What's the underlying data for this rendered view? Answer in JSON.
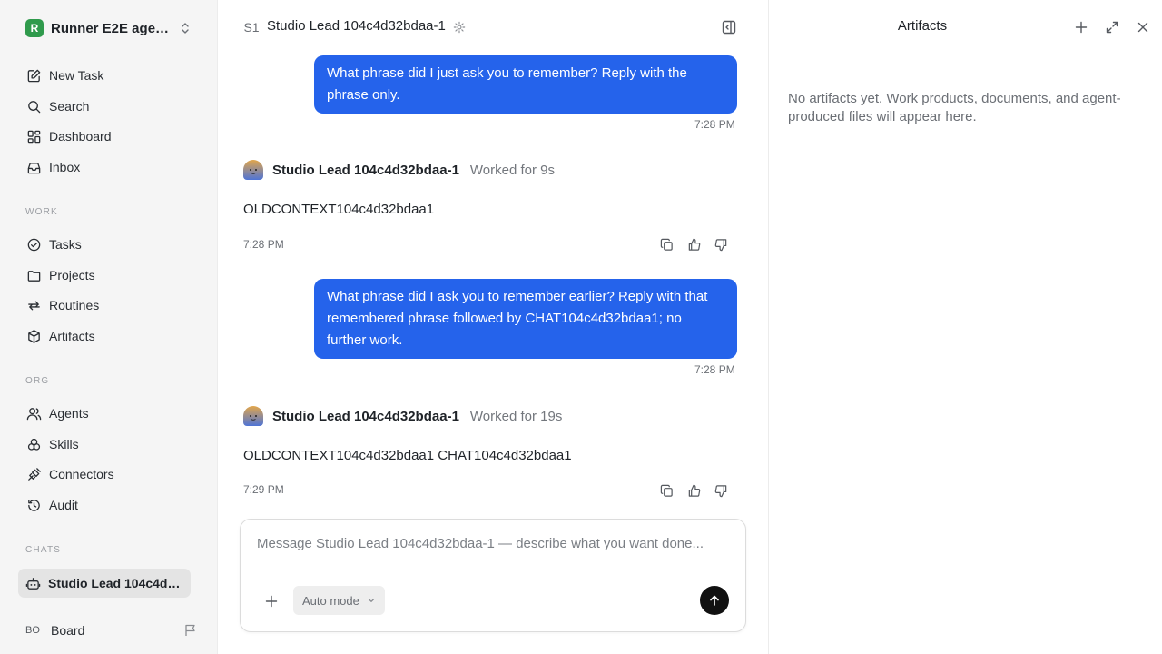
{
  "workspace": {
    "name": "Runner E2E agents",
    "logo_letter": "R",
    "logo_color": "#2f9a4c"
  },
  "nav": {
    "new_task": "New Task",
    "search": "Search",
    "dashboard": "Dashboard",
    "inbox": "Inbox"
  },
  "sections": {
    "work": "WORK",
    "org": "ORG",
    "chats": "CHATS"
  },
  "work_items": {
    "tasks": "Tasks",
    "projects": "Projects",
    "routines": "Routines",
    "artifacts": "Artifacts"
  },
  "org_items": {
    "agents": "Agents",
    "skills": "Skills",
    "connectors": "Connectors",
    "audit": "Audit"
  },
  "chats": {
    "active": "Studio Lead 104c4d32bdaa-1"
  },
  "user": {
    "initials": "BO",
    "name": "Board"
  },
  "chat": {
    "badge": "S1",
    "title": "Studio Lead 104c4d32bdaa-1",
    "messages": [
      {
        "user_text": "What phrase did I just ask you to remember? Reply with the phrase only.",
        "user_time": "7:28 PM",
        "agent_name": "Studio Lead 104c4d32bdaa-1",
        "agent_worked": "Worked for 9s",
        "agent_text": "OLDCONTEXT104c4d32bdaa1",
        "agent_time": "7:28 PM"
      },
      {
        "user_text": "What phrase did I ask you to remember earlier? Reply with that remembered phrase followed by CHAT104c4d32bdaa1; no further work.",
        "user_time": "7:28 PM",
        "agent_name": "Studio Lead 104c4d32bdaa-1",
        "agent_worked": "Worked for 19s",
        "agent_text": "OLDCONTEXT104c4d32bdaa1 CHAT104c4d32bdaa1",
        "agent_time": "7:29 PM"
      }
    ],
    "composer": {
      "placeholder": "Message Studio Lead 104c4d32bdaa-1 — describe what you want done...",
      "mode": "Auto mode"
    }
  },
  "artifacts": {
    "title": "Artifacts",
    "empty_text": "No artifacts yet. Work products, documents, and agent-produced files will appear here."
  },
  "colors": {
    "user_bubble": "#2563eb",
    "sidebar_bg": "#f5f5f5",
    "send_button": "#111111"
  }
}
